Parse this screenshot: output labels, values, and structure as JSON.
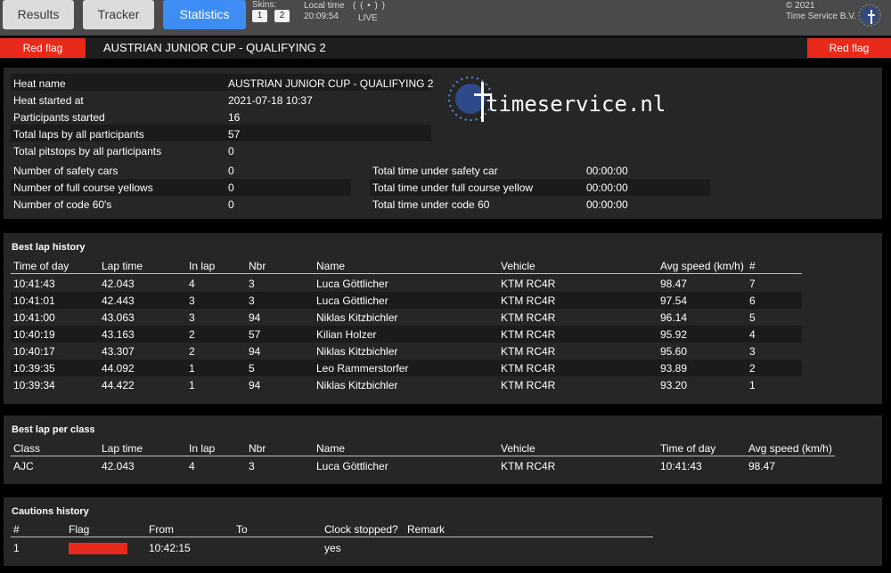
{
  "nav": {
    "results": "Results",
    "tracker": "Tracker",
    "statistics": "Statistics"
  },
  "skins": {
    "label": "Skins:",
    "s1": "1",
    "s2": "2"
  },
  "clock": {
    "label": "Local time",
    "value": "20:09:54"
  },
  "live": {
    "icon": "( ( • ) )",
    "label": "LIVE"
  },
  "copyright": {
    "line1": "© 2021",
    "line2": "Time Service B.V."
  },
  "flagbar": {
    "left": "Red flag",
    "title": "AUSTRIAN JUNIOR CUP - QUALIFYING 2",
    "right": "Red flag",
    "color": "#e8291c"
  },
  "summary": {
    "heat_name_lbl": "Heat name",
    "heat_name": "AUSTRIAN JUNIOR CUP - QUALIFYING 2",
    "started_lbl": "Heat started at",
    "started": "2021-07-18 10:37",
    "participants_lbl": "Participants started",
    "participants": "16",
    "laps_lbl": "Total laps by all participants",
    "laps": "57",
    "pitstops_lbl": "Total pitstops by all participants",
    "pitstops": "0",
    "safety_lbl": "Number of safety cars",
    "safety": "0",
    "fcy_lbl": "Number of full course yellows",
    "fcy": "0",
    "code60_lbl": "Number of code 60's",
    "code60": "0",
    "t_safety_lbl": "Total time under safety car",
    "t_safety": "00:00:00",
    "t_fcy_lbl": "Total time under full course yellow",
    "t_fcy": "00:00:00",
    "t_code60_lbl": "Total time under code 60",
    "t_code60": "00:00:00",
    "logo_text": "timeservice.nl"
  },
  "best_laps": {
    "title": "Best lap history",
    "headers": [
      "Time of day",
      "Lap time",
      "In lap",
      "Nbr",
      "Name",
      "Vehicle",
      "Avg speed (km/h)",
      "#"
    ],
    "rows": [
      [
        "10:41:43",
        "42.043",
        "4",
        "3",
        "Luca Göttlicher",
        "KTM RC4R",
        "98.47",
        "7"
      ],
      [
        "10:41:01",
        "42.443",
        "3",
        "3",
        "Luca Göttlicher",
        "KTM RC4R",
        "97.54",
        "6"
      ],
      [
        "10:41:00",
        "43.063",
        "3",
        "94",
        "Niklas Kitzbichler",
        "KTM RC4R",
        "96.14",
        "5"
      ],
      [
        "10:40:19",
        "43.163",
        "2",
        "57",
        "Kilian Holzer",
        "KTM RC4R",
        "95.92",
        "4"
      ],
      [
        "10:40:17",
        "43.307",
        "2",
        "94",
        "Niklas Kitzbichler",
        "KTM RC4R",
        "95.60",
        "3"
      ],
      [
        "10:39:35",
        "44.092",
        "1",
        "5",
        "Leo Rammerstorfer",
        "KTM RC4R",
        "93.89",
        "2"
      ],
      [
        "10:39:34",
        "44.422",
        "1",
        "94",
        "Niklas Kitzbichler",
        "KTM RC4R",
        "93.20",
        "1"
      ]
    ]
  },
  "best_class": {
    "title": "Best lap per class",
    "headers": [
      "Class",
      "Lap time",
      "In lap",
      "Nbr",
      "Name",
      "Vehicle",
      "Time of day",
      "Avg speed (km/h)"
    ],
    "rows": [
      [
        "AJC",
        "42.043",
        "4",
        "3",
        "Luca Göttlicher",
        "KTM RC4R",
        "10:41:43",
        "98.47"
      ]
    ]
  },
  "cautions": {
    "title": "Cautions history",
    "headers": [
      "#",
      "Flag",
      "From",
      "To",
      "Clock stopped?",
      "Remark"
    ],
    "rows": [
      {
        "num": "1",
        "flag_color": "#e8291c",
        "from": "10:42:15",
        "to": "",
        "clock": "yes",
        "remark": ""
      }
    ]
  }
}
